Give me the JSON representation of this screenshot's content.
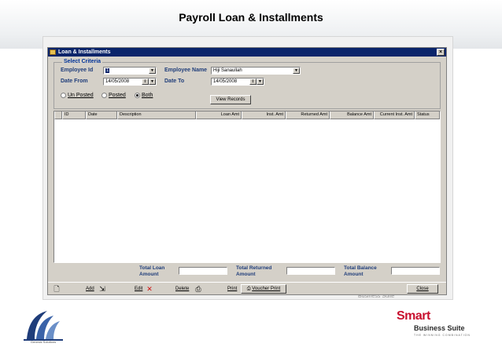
{
  "slide": {
    "title": "Payroll  Loan & Installments"
  },
  "window": {
    "title": "Loan & Installments",
    "close_label": "×"
  },
  "criteria": {
    "legend": "Select Criteria",
    "employee_id_label": "Employee Id",
    "employee_id_value": "1",
    "employee_name_label": "Employee Name",
    "employee_name_value": "Hiji Sanaullah",
    "date_from_label": "Date From",
    "date_from_value": "14/05/2008",
    "date_to_label": "Date To",
    "date_to_value": "14/05/2008",
    "radios": [
      {
        "label": "Un Posted",
        "selected": false
      },
      {
        "label": "Posted",
        "selected": false
      },
      {
        "label": "Both",
        "selected": true
      }
    ],
    "view_button": "View Records"
  },
  "grid": {
    "columns": [
      "ID",
      "Date",
      "Description",
      "Loan Amt",
      "Inst. Amt",
      "Returned Amt",
      "Balance Amt",
      "Current Inst. Amt",
      "Status"
    ]
  },
  "totals": {
    "loan_label_1": "Total Loan",
    "loan_label_2": "Amount",
    "returned_label_1": "Total Returned",
    "returned_label_2": "Amount",
    "balance_label_1": "Total Balance",
    "balance_label_2": "Amount"
  },
  "toolbar": {
    "add": "Add",
    "edit": "Edit",
    "delete": "Delete",
    "print": "Print",
    "voucher_print": "Voucher Print",
    "close": "Close"
  },
  "background_text": "Business Suite",
  "logos": {
    "left_caption": "Genesis Solutions",
    "right_word_1": "Smart",
    "right_word_2": "Business Suite",
    "right_tagline": "THE WINNING COMBINATION"
  },
  "colors": {
    "titlebar": "#0a246a",
    "window_face": "#d4d0c8",
    "label_blue": "#1f3d7a",
    "logo_red": "#c8102e"
  }
}
